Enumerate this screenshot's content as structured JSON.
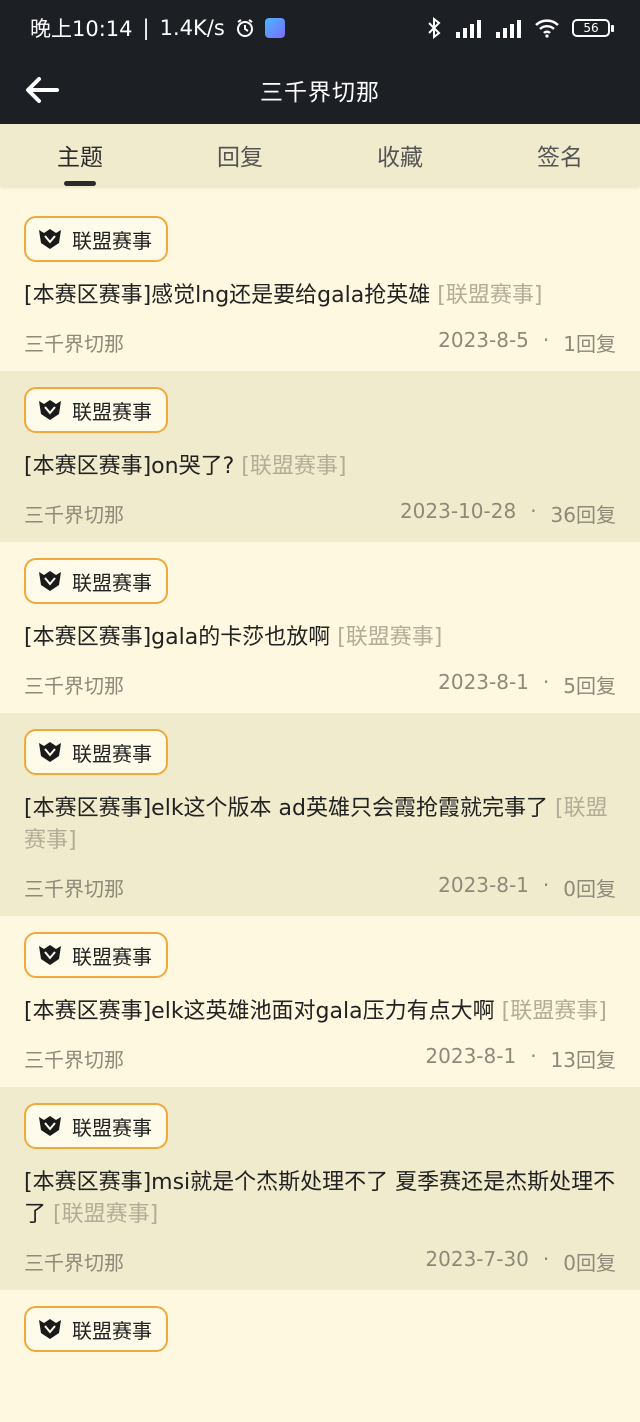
{
  "status_bar": {
    "time": "晚上10:14",
    "speed": "1.4K/s",
    "battery": "56"
  },
  "header": {
    "title": "三千界切那"
  },
  "tabs": [
    {
      "label": "主题",
      "active": true
    },
    {
      "label": "回复",
      "active": false
    },
    {
      "label": "收藏",
      "active": false
    },
    {
      "label": "签名",
      "active": false
    }
  ],
  "posts": [
    {
      "badge": "联盟赛事",
      "title": "[本赛区赛事]感觉lng还是要给gala抢英雄",
      "tag": "[联盟赛事]",
      "author": "三千界切那",
      "date": "2023-8-5",
      "replies": "1回复"
    },
    {
      "badge": "联盟赛事",
      "title": "[本赛区赛事]on哭了?",
      "tag": "[联盟赛事]",
      "author": "三千界切那",
      "date": "2023-10-28",
      "replies": "36回复"
    },
    {
      "badge": "联盟赛事",
      "title": "[本赛区赛事]gala的卡莎也放啊",
      "tag": "[联盟赛事]",
      "author": "三千界切那",
      "date": "2023-8-1",
      "replies": "5回复"
    },
    {
      "badge": "联盟赛事",
      "title": "[本赛区赛事]elk这个版本 ad英雄只会霞抢霞就完事了",
      "tag": "[联盟赛事]",
      "author": "三千界切那",
      "date": "2023-8-1",
      "replies": "0回复"
    },
    {
      "badge": "联盟赛事",
      "title": "[本赛区赛事]elk这英雄池面对gala压力有点大啊",
      "tag": "[联盟赛事]",
      "author": "三千界切那",
      "date": "2023-8-1",
      "replies": "13回复"
    },
    {
      "badge": "联盟赛事",
      "title": "[本赛区赛事]msi就是个杰斯处理不了 夏季赛还是杰斯处理不了",
      "tag": "[联盟赛事]",
      "author": "三千界切那",
      "date": "2023-7-30",
      "replies": "0回复"
    },
    {
      "badge": "联盟赛事",
      "title": "",
      "tag": "",
      "author": "",
      "date": "",
      "replies": ""
    }
  ]
}
